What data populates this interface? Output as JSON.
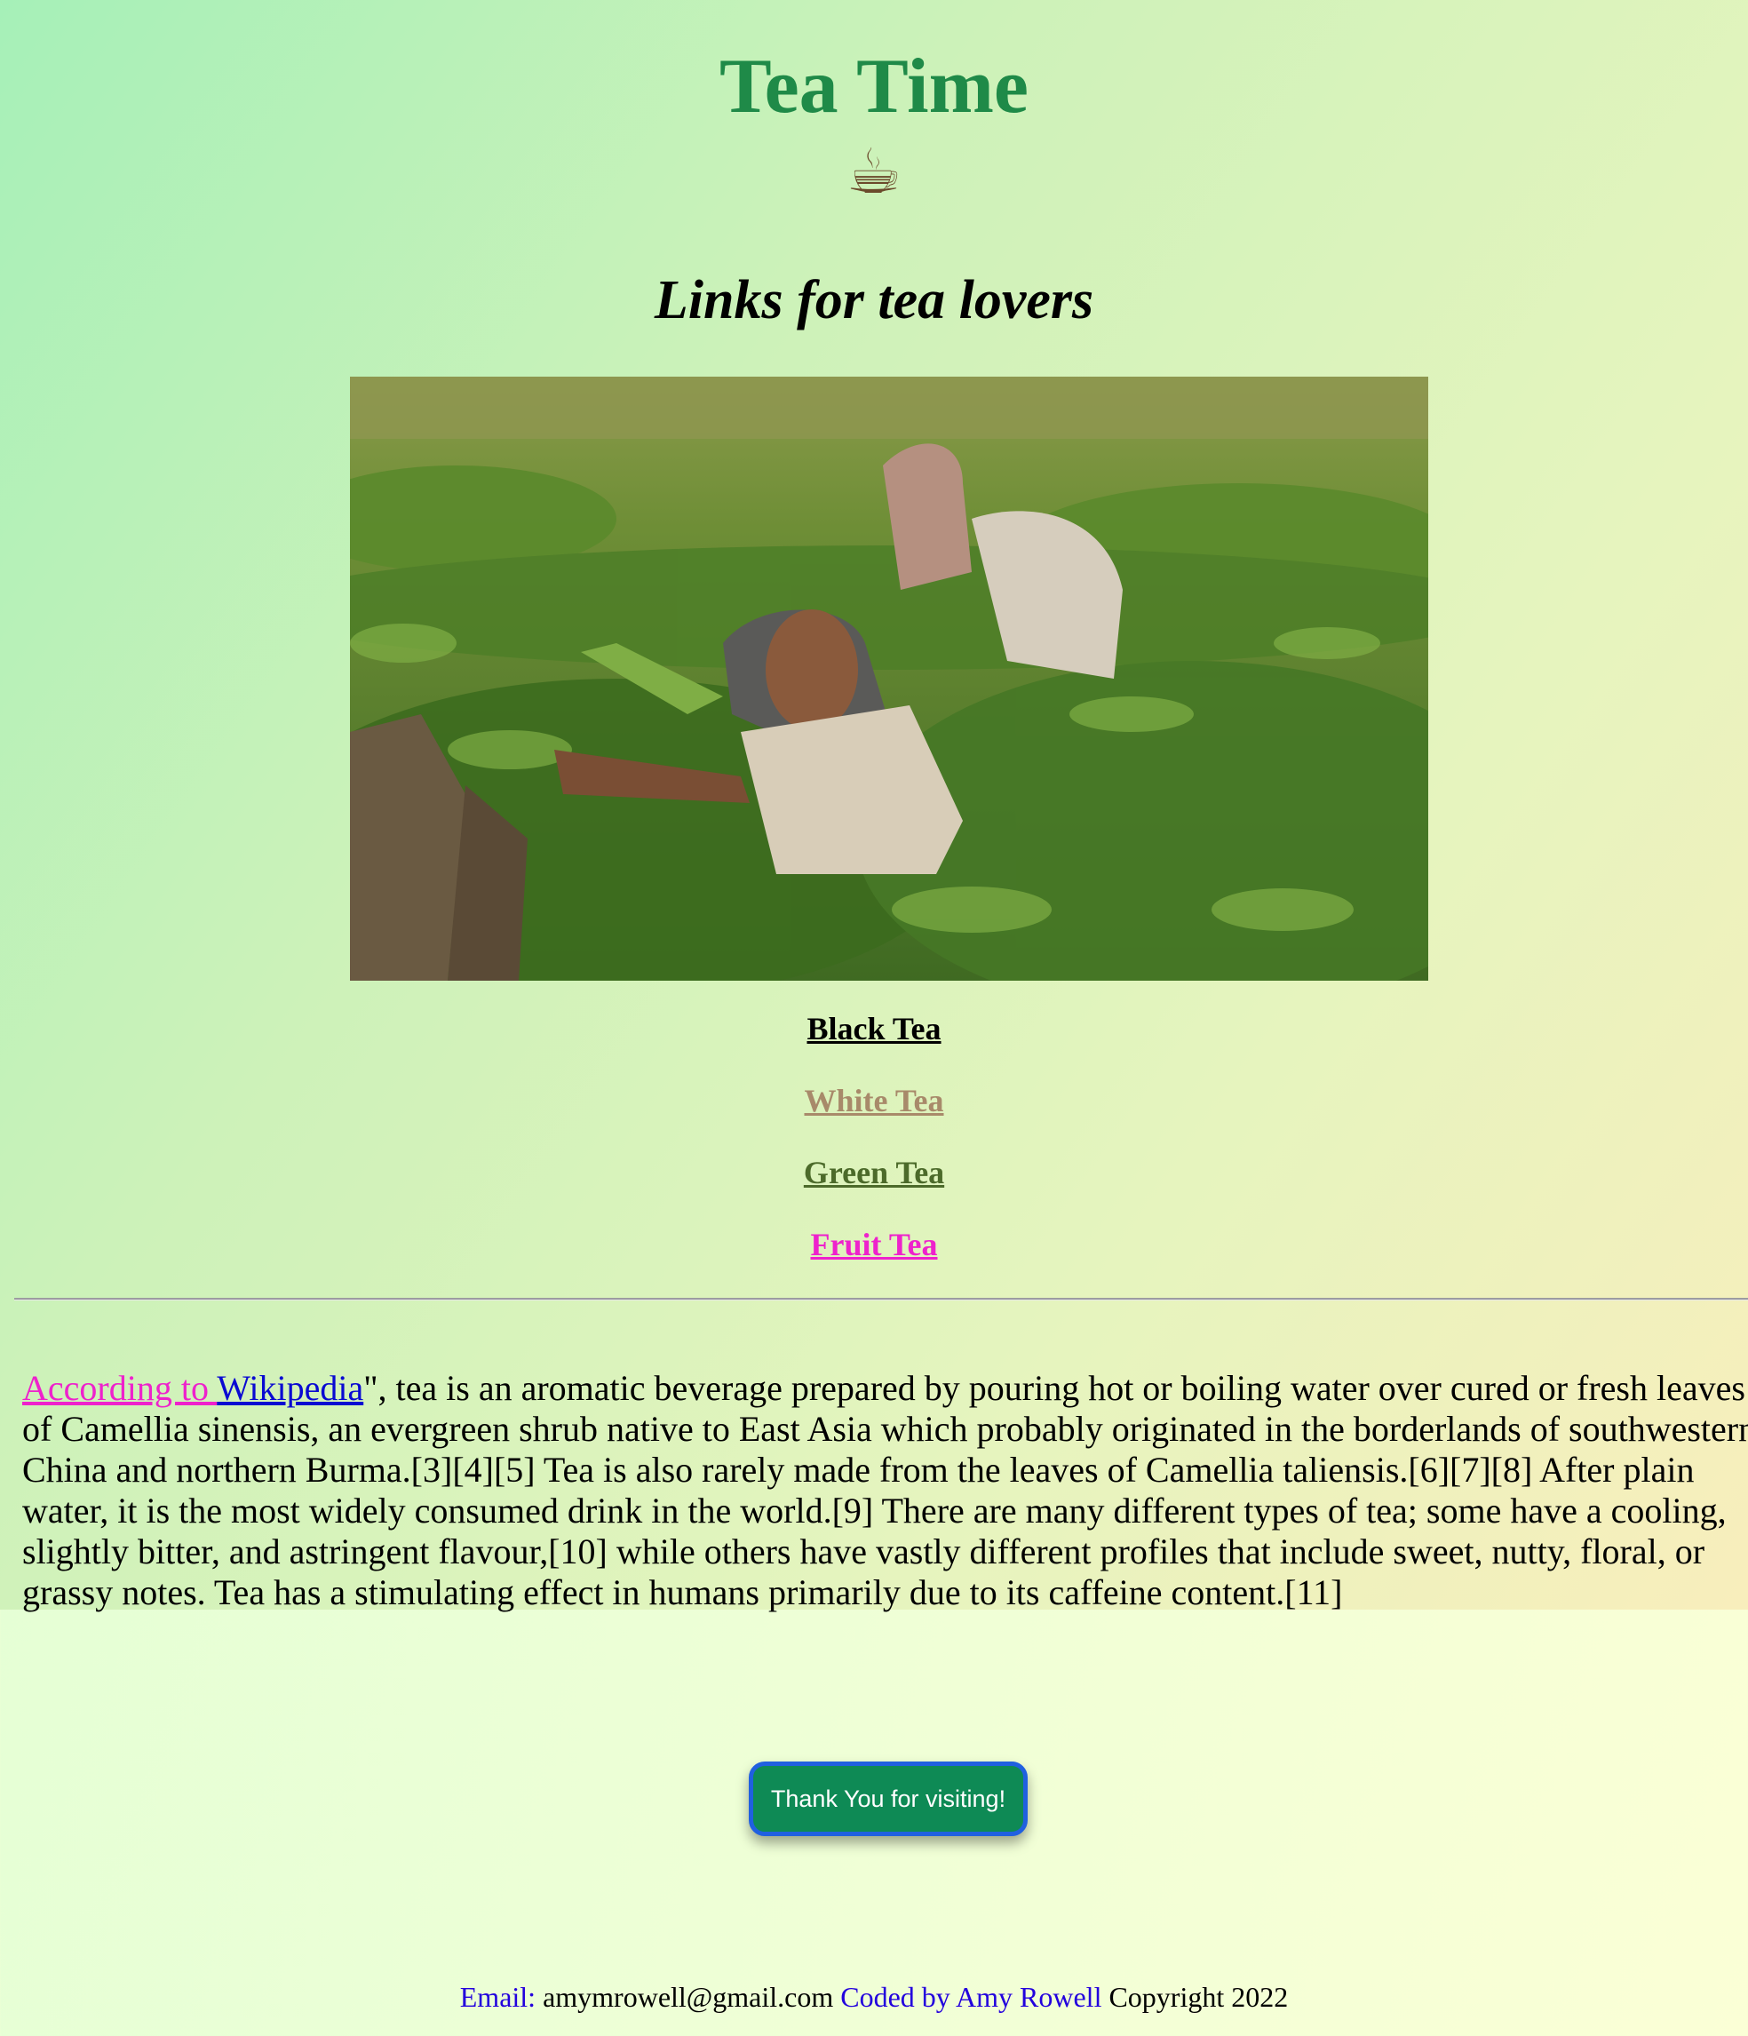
{
  "header": {
    "title": "Tea Time",
    "cup_icon": "☕",
    "subtitle": "Links for tea lovers"
  },
  "hero": {
    "icon": "tea-plantation-photo"
  },
  "tea_links": [
    {
      "label": "Black Tea",
      "color": "#000000"
    },
    {
      "label": "White Tea",
      "color": "#a88a6a"
    },
    {
      "label": "Green Tea",
      "color": "#4c6a2a"
    },
    {
      "label": "Fruit Tea",
      "color": "#ee22cc"
    }
  ],
  "article": {
    "according_link": "According to ",
    "wikipedia_link": "Wikipedia",
    "lines": [
      "\", tea is an aromatic beverage prepared by pouring hot or boiling water over cured or fresh leaves",
      "of Camellia sinensis, an evergreen shrub native to East Asia which probably originated in the borderlands of southwestern",
      "China and northern Burma.[3][4][5] Tea is also rarely made from the leaves of Camellia taliensis.[6][7][8] After plain",
      "water, it is the most widely consumed drink in the world.[9] There are many different types of tea; some have a cooling,",
      "slightly bitter, and astringent flavour,[10] while others have vastly different profiles that include sweet, nutty, floral, or",
      "grassy notes. Tea has a stimulating effect in humans primarily due to its caffeine content.[11]"
    ]
  },
  "thanks_button": "Thank You for visiting!",
  "footer": {
    "email_label": "Email:",
    "email": " amymrowell@gmail.com ",
    "coded_by": "Coded by Amy Rowell",
    "copyright": " Copyright 2022"
  }
}
